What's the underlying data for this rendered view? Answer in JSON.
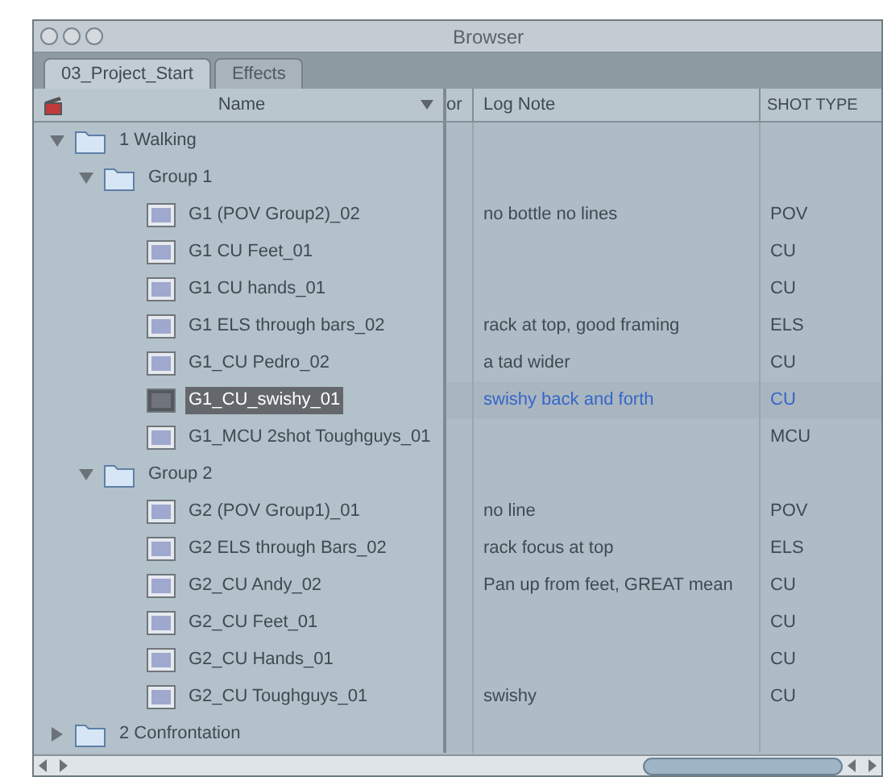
{
  "window": {
    "title": "Browser"
  },
  "tabs": [
    {
      "label": "03_Project_Start",
      "selected": true
    },
    {
      "label": "Effects",
      "selected": false
    }
  ],
  "columns": [
    {
      "label": "Name"
    },
    {
      "label": "or"
    },
    {
      "label": "Log Note"
    },
    {
      "label": "SHOT TYPE"
    }
  ],
  "tree": [
    {
      "kind": "bin",
      "name": "1 Walking",
      "expanded": true,
      "children": [
        {
          "kind": "bin",
          "name": "Group 1",
          "expanded": true,
          "children": [
            {
              "kind": "clip",
              "name": "G1 (POV Group2)_02",
              "log_note": "no bottle no lines",
              "shot_type": "POV",
              "selected": false
            },
            {
              "kind": "clip",
              "name": "G1 CU Feet_01",
              "shot_type": "CU",
              "selected": false
            },
            {
              "kind": "clip",
              "name": "G1 CU hands_01",
              "shot_type": "CU",
              "selected": false
            },
            {
              "kind": "clip",
              "name": "G1 ELS through bars_02",
              "log_note": "rack at top, good framing",
              "shot_type": "ELS",
              "selected": false
            },
            {
              "kind": "clip",
              "name": "G1_CU Pedro_02",
              "log_note": "a tad wider",
              "shot_type": "CU",
              "selected": false
            },
            {
              "kind": "clip",
              "name": "G1_CU_swishy_01",
              "log_note": "swishy back and forth",
              "shot_type": "CU",
              "selected": true
            },
            {
              "kind": "clip",
              "name": "G1_MCU 2shot Toughguys_01",
              "shot_type": "MCU",
              "selected": false
            }
          ]
        },
        {
          "kind": "bin",
          "name": "Group 2",
          "expanded": true,
          "children": [
            {
              "kind": "clip",
              "name": "G2 (POV Group1)_01",
              "log_note": "no line",
              "shot_type": "POV",
              "selected": false
            },
            {
              "kind": "clip",
              "name": "G2 ELS through Bars_02",
              "log_note": "rack focus at top",
              "shot_type": "ELS",
              "selected": false
            },
            {
              "kind": "clip",
              "name": "G2_CU Andy_02",
              "log_note": "Pan up from feet, GREAT mean",
              "shot_type": "CU",
              "selected": false
            },
            {
              "kind": "clip",
              "name": "G2_CU Feet_01",
              "shot_type": "CU",
              "selected": false
            },
            {
              "kind": "clip",
              "name": "G2_CU Hands_01",
              "shot_type": "CU",
              "selected": false
            },
            {
              "kind": "clip",
              "name": "G2_CU Toughguys_01",
              "log_note": "swishy",
              "shot_type": "CU",
              "selected": false
            }
          ]
        }
      ]
    },
    {
      "kind": "bin",
      "name": "2 Confrontation",
      "expanded": false
    }
  ]
}
